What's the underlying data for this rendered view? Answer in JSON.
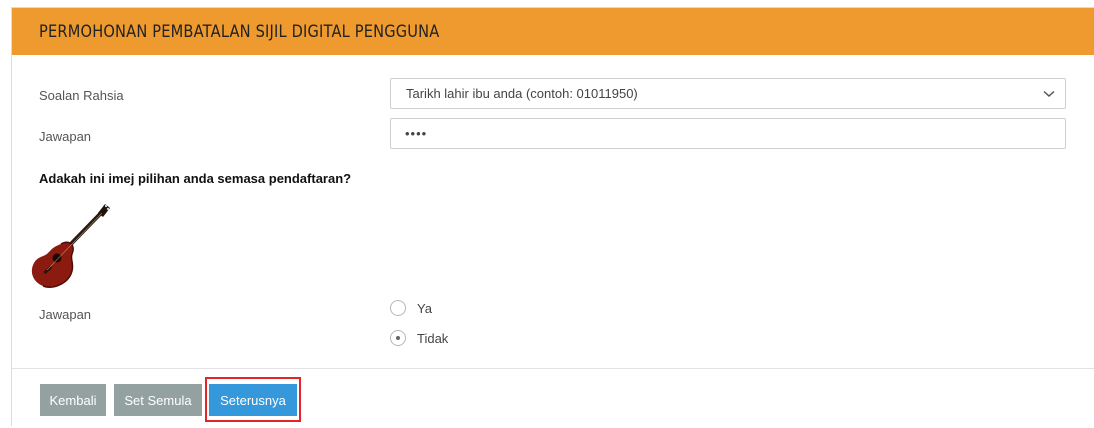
{
  "header": {
    "title": "PERMOHONAN PEMBATALAN SIJIL DIGITAL PENGGUNA"
  },
  "form": {
    "secret_question_label": "Soalan Rahsia",
    "secret_question_value": "Tarikh lahir ibu anda (contoh: 01011950)",
    "answer_label": "Jawapan",
    "answer_value": "••••",
    "image_question": "Adakah ini imej pilihan anda semasa pendaftaran?",
    "image_icon": "guitar-image",
    "image_answer_label": "Jawapan",
    "options": [
      {
        "label": "Ya",
        "selected": false
      },
      {
        "label": "Tidak",
        "selected": true
      }
    ]
  },
  "footer": {
    "back_label": "Kembali",
    "reset_label": "Set Semula",
    "next_label": "Seterusnya"
  },
  "colors": {
    "header_bg": "#ee9a2f",
    "grey_button": "#93a1a1",
    "primary_button": "#3498db",
    "highlight_border": "#e3242b"
  }
}
